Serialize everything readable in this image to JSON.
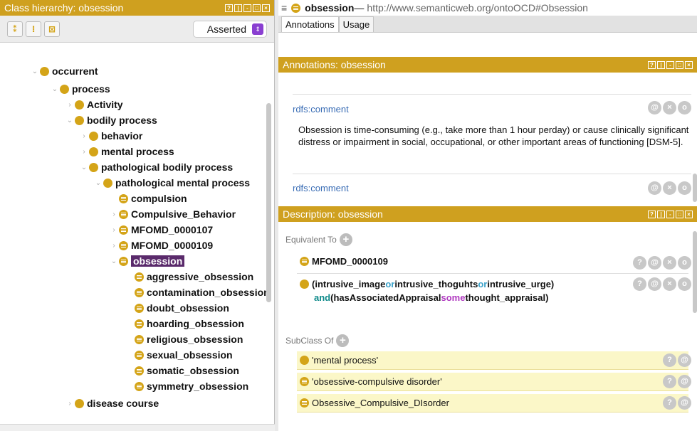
{
  "left_panel": {
    "title": "Class hierarchy: obsession",
    "select_value": "Asserted",
    "tree": [
      {
        "label": "occurrent",
        "icon": "class-dot-icon"
      },
      {
        "label": "process",
        "icon": "class-dot-icon"
      },
      {
        "label": "Activity",
        "icon": "class-dot-icon"
      },
      {
        "label": "bodily process",
        "icon": "class-dot-icon"
      },
      {
        "label": "behavior",
        "icon": "class-dot-icon"
      },
      {
        "label": "mental process",
        "icon": "class-dot-icon"
      },
      {
        "label": "pathological bodily process",
        "icon": "class-dot-icon"
      },
      {
        "label": "pathological mental process",
        "icon": "class-dot-icon"
      },
      {
        "label": "compulsion",
        "icon": "defined-class-icon"
      },
      {
        "label": "Compulsive_Behavior",
        "icon": "defined-class-icon"
      },
      {
        "label": "MFOMD_0000107",
        "icon": "defined-class-icon"
      },
      {
        "label": "MFOMD_0000109",
        "icon": "defined-class-icon"
      },
      {
        "label": "obsession",
        "icon": "defined-class-icon"
      },
      {
        "label": "aggressive_obsession",
        "icon": "defined-class-icon"
      },
      {
        "label": "contamination_obsession",
        "icon": "defined-class-icon"
      },
      {
        "label": "doubt_obsession",
        "icon": "defined-class-icon"
      },
      {
        "label": "hoarding_obsession",
        "icon": "defined-class-icon"
      },
      {
        "label": "religious_obsession",
        "icon": "defined-class-icon"
      },
      {
        "label": "sexual_obsession",
        "icon": "defined-class-icon"
      },
      {
        "label": "somatic_obsession",
        "icon": "defined-class-icon"
      },
      {
        "label": "symmetry_obsession",
        "icon": "defined-class-icon"
      },
      {
        "label": "disease course",
        "icon": "class-dot-icon"
      }
    ]
  },
  "right_panel": {
    "entity": "obsession",
    "url_sep": " — ",
    "url": "http://www.semanticweb.org/ontoOCD#Obsession",
    "tabs": [
      "Annotations",
      "Usage"
    ],
    "annotations_title": "Annotations: obsession",
    "annotations": [
      {
        "property": "rdfs:comment",
        "text": "Obsession is time-consuming (e.g., take more than 1 hour perday)  or  cause  clinically significant  distress or impairment in social, occupational,  or other important areas of functioning [DSM-5]."
      },
      {
        "property": "rdfs:comment",
        "text": ""
      }
    ],
    "description_title": "Description: obsession",
    "equivalent_label": "Equivalent To",
    "equivalent": {
      "item1": "MFOMD_0000109",
      "line1_a": "(intrusive_image ",
      "or1": "or",
      "line1_b": " intrusive_thoguhts ",
      "or2": "or",
      "line1_c": " intrusive_urge)",
      "and": "and",
      "line2_a": " (hasAssociatedAppraisal ",
      "some": "some",
      "line2_b": " thought_appraisal)"
    },
    "subclass_label": "SubClass Of",
    "subclasses": [
      "'mental process'",
      "'obsessive-compulsive disorder'",
      "Obsessive_Compulsive_DIsorder"
    ]
  },
  "colors": {
    "accent": "#cfa01f",
    "selection": "#5a2a6b",
    "link": "#3a6db5"
  }
}
